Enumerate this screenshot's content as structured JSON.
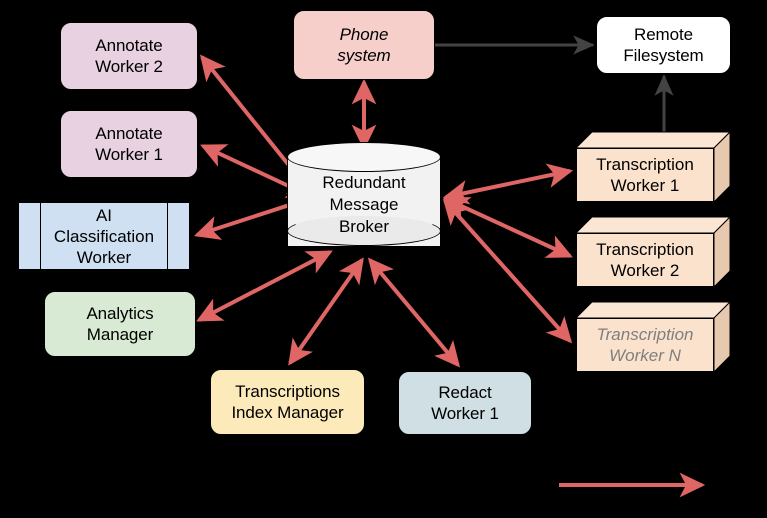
{
  "diagram": {
    "title": "Redundant Message Broker architecture",
    "background": "#000000",
    "colors": {
      "message_arrow": "#e06666",
      "file_arrow": "#434343",
      "annotate_fill": "#e8d2e1",
      "phone_fill": "#f6cfcb",
      "remote_fs_fill": "#ffffff",
      "analytics_fill": "#d8ead3",
      "transcriptions_index_fill": "#fdeaba",
      "redact_fill": "#cfdfe3",
      "ai_classification_fill": "#cfe0f3",
      "transcription_worker_fill": "#fbe2cc",
      "broker_fill": "#f2f2f2",
      "dim_text": "#7f7f7f"
    },
    "nodes": {
      "annotate_worker_2": {
        "label": "Annotate\nWorker 2",
        "shape": "rounded-rectangle"
      },
      "annotate_worker_1": {
        "label": "Annotate\nWorker 1",
        "shape": "rounded-rectangle"
      },
      "ai_classification_worker": {
        "label": "AI\nClassification\nWorker",
        "shape": "process"
      },
      "analytics_manager": {
        "label": "Analytics\nManager",
        "shape": "rounded-rectangle"
      },
      "phone_system": {
        "label": "Phone\nsystem",
        "shape": "rounded-rectangle",
        "style": "italic"
      },
      "remote_filesystem": {
        "label": "Remote\nFilesystem",
        "shape": "rounded-rectangle"
      },
      "redundant_message_broker": {
        "label": "Redundant\nMessage\nBroker",
        "shape": "cylinder"
      },
      "transcription_worker_1": {
        "label": "Transcription\nWorker 1",
        "shape": "cube"
      },
      "transcription_worker_2": {
        "label": "Transcription\nWorker 2",
        "shape": "cube"
      },
      "transcription_worker_n": {
        "label": "Transcription\nWorker N",
        "shape": "cube",
        "style": "italic-dimmed"
      },
      "transcriptions_index_manager": {
        "label": "Transcriptions\nIndex Manager",
        "shape": "rounded-rectangle"
      },
      "redact_worker_1": {
        "label": "Redact\nWorker 1",
        "shape": "rounded-rectangle"
      }
    },
    "edges": [
      {
        "from": "redundant_message_broker",
        "to": "annotate_worker_2",
        "kind": "message",
        "arrows": "both"
      },
      {
        "from": "redundant_message_broker",
        "to": "annotate_worker_1",
        "kind": "message",
        "arrows": "both"
      },
      {
        "from": "redundant_message_broker",
        "to": "ai_classification_worker",
        "kind": "message",
        "arrows": "both"
      },
      {
        "from": "redundant_message_broker",
        "to": "analytics_manager",
        "kind": "message",
        "arrows": "both"
      },
      {
        "from": "phone_system",
        "to": "redundant_message_broker",
        "kind": "message",
        "arrows": "both"
      },
      {
        "from": "redundant_message_broker",
        "to": "transcription_worker_1",
        "kind": "message",
        "arrows": "both"
      },
      {
        "from": "redundant_message_broker",
        "to": "transcription_worker_2",
        "kind": "message",
        "arrows": "both"
      },
      {
        "from": "redundant_message_broker",
        "to": "transcription_worker_n",
        "kind": "message",
        "arrows": "both"
      },
      {
        "from": "redundant_message_broker",
        "to": "transcriptions_index_manager",
        "kind": "message",
        "arrows": "both"
      },
      {
        "from": "redundant_message_broker",
        "to": "redact_worker_1",
        "kind": "message",
        "arrows": "both"
      },
      {
        "from": "phone_system",
        "to": "remote_filesystem",
        "kind": "file",
        "arrows": "end"
      },
      {
        "from": "transcription_worker_1",
        "to": "remote_filesystem",
        "kind": "file",
        "arrows": "end"
      }
    ],
    "legend": {
      "arrow_label": "",
      "arrow_kind": "message"
    }
  }
}
